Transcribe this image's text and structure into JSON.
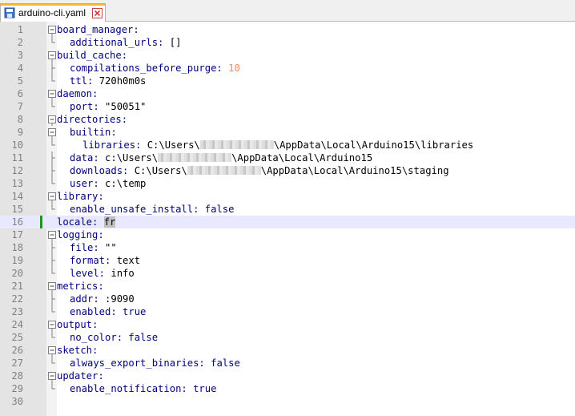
{
  "tab": {
    "filename": "arduino-cli.yaml"
  },
  "lines": [
    {
      "num": "1",
      "fold": "open",
      "indent": 0,
      "segments": [
        {
          "t": "board_manager:",
          "c": "k"
        }
      ]
    },
    {
      "num": "2",
      "fold": "end",
      "indent": 1,
      "segments": [
        {
          "t": "additional_urls:",
          "c": "k"
        },
        {
          "t": " []",
          "c": "v"
        }
      ]
    },
    {
      "num": "3",
      "fold": "open",
      "indent": 0,
      "segments": [
        {
          "t": "build_cache:",
          "c": "k"
        }
      ]
    },
    {
      "num": "4",
      "fold": "mid",
      "indent": 1,
      "segments": [
        {
          "t": "compilations_before_purge:",
          "c": "k"
        },
        {
          "t": " ",
          "c": "v"
        },
        {
          "t": "10",
          "c": "n"
        }
      ]
    },
    {
      "num": "5",
      "fold": "end",
      "indent": 1,
      "segments": [
        {
          "t": "ttl:",
          "c": "k"
        },
        {
          "t": " 720h0m0s",
          "c": "v"
        }
      ]
    },
    {
      "num": "6",
      "fold": "open",
      "indent": 0,
      "segments": [
        {
          "t": "daemon:",
          "c": "k"
        }
      ]
    },
    {
      "num": "7",
      "fold": "end",
      "indent": 1,
      "segments": [
        {
          "t": "port:",
          "c": "k"
        },
        {
          "t": " \"50051\"",
          "c": "v"
        }
      ]
    },
    {
      "num": "8",
      "fold": "open",
      "indent": 0,
      "segments": [
        {
          "t": "directories:",
          "c": "k"
        }
      ]
    },
    {
      "num": "9",
      "fold": "open2",
      "indent": 1,
      "segments": [
        {
          "t": "builtin:",
          "c": "k"
        }
      ]
    },
    {
      "num": "10",
      "fold": "end2",
      "indent": 2,
      "segments": [
        {
          "t": "libraries:",
          "c": "k"
        },
        {
          "t": " C:\\Users\\",
          "c": "v"
        },
        {
          "t": "",
          "c": "blur"
        },
        {
          "t": "\\AppData\\Local\\Arduino15\\libraries",
          "c": "v"
        }
      ]
    },
    {
      "num": "11",
      "fold": "mid",
      "indent": 1,
      "segments": [
        {
          "t": "data:",
          "c": "k"
        },
        {
          "t": " c:\\Users\\",
          "c": "v"
        },
        {
          "t": "",
          "c": "blur"
        },
        {
          "t": "\\AppData\\Local\\Arduino15",
          "c": "v"
        }
      ]
    },
    {
      "num": "12",
      "fold": "mid",
      "indent": 1,
      "segments": [
        {
          "t": "downloads:",
          "c": "k"
        },
        {
          "t": " C:\\Users\\",
          "c": "v"
        },
        {
          "t": "",
          "c": "blur"
        },
        {
          "t": "\\AppData\\Local\\Arduino15\\staging",
          "c": "v"
        }
      ]
    },
    {
      "num": "13",
      "fold": "end",
      "indent": 1,
      "segments": [
        {
          "t": "user:",
          "c": "k"
        },
        {
          "t": " c:\\temp",
          "c": "v"
        }
      ]
    },
    {
      "num": "14",
      "fold": "open",
      "indent": 0,
      "segments": [
        {
          "t": "library:",
          "c": "k"
        }
      ]
    },
    {
      "num": "15",
      "fold": "end",
      "indent": 1,
      "segments": [
        {
          "t": "enable_unsafe_install:",
          "c": "k"
        },
        {
          "t": " ",
          "c": "v"
        },
        {
          "t": "false",
          "c": "b"
        }
      ]
    },
    {
      "num": "16",
      "fold": "none",
      "indent": 0,
      "current": true,
      "changed": true,
      "segments": [
        {
          "t": "locale:",
          "c": "k"
        },
        {
          "t": " ",
          "c": "v"
        },
        {
          "t": "fr",
          "c": "sel"
        }
      ]
    },
    {
      "num": "17",
      "fold": "open",
      "indent": 0,
      "segments": [
        {
          "t": "logging:",
          "c": "k"
        }
      ]
    },
    {
      "num": "18",
      "fold": "mid",
      "indent": 1,
      "segments": [
        {
          "t": "file:",
          "c": "k"
        },
        {
          "t": " \"\"",
          "c": "v"
        }
      ]
    },
    {
      "num": "19",
      "fold": "mid",
      "indent": 1,
      "segments": [
        {
          "t": "format:",
          "c": "k"
        },
        {
          "t": " text",
          "c": "v"
        }
      ]
    },
    {
      "num": "20",
      "fold": "end",
      "indent": 1,
      "segments": [
        {
          "t": "level:",
          "c": "k"
        },
        {
          "t": " info",
          "c": "v"
        }
      ]
    },
    {
      "num": "21",
      "fold": "open",
      "indent": 0,
      "segments": [
        {
          "t": "metrics:",
          "c": "k"
        }
      ]
    },
    {
      "num": "22",
      "fold": "mid",
      "indent": 1,
      "segments": [
        {
          "t": "addr:",
          "c": "k"
        },
        {
          "t": " :9090",
          "c": "v"
        }
      ]
    },
    {
      "num": "23",
      "fold": "end",
      "indent": 1,
      "segments": [
        {
          "t": "enabled:",
          "c": "k"
        },
        {
          "t": " ",
          "c": "v"
        },
        {
          "t": "true",
          "c": "b"
        }
      ]
    },
    {
      "num": "24",
      "fold": "open",
      "indent": 0,
      "segments": [
        {
          "t": "output:",
          "c": "k"
        }
      ]
    },
    {
      "num": "25",
      "fold": "end",
      "indent": 1,
      "segments": [
        {
          "t": "no_color:",
          "c": "k"
        },
        {
          "t": " ",
          "c": "v"
        },
        {
          "t": "false",
          "c": "b"
        }
      ]
    },
    {
      "num": "26",
      "fold": "open",
      "indent": 0,
      "segments": [
        {
          "t": "sketch:",
          "c": "k"
        }
      ]
    },
    {
      "num": "27",
      "fold": "end",
      "indent": 1,
      "segments": [
        {
          "t": "always_export_binaries:",
          "c": "k"
        },
        {
          "t": " ",
          "c": "v"
        },
        {
          "t": "false",
          "c": "b"
        }
      ]
    },
    {
      "num": "28",
      "fold": "open",
      "indent": 0,
      "segments": [
        {
          "t": "updater:",
          "c": "k"
        }
      ]
    },
    {
      "num": "29",
      "fold": "end",
      "indent": 1,
      "segments": [
        {
          "t": "enable_notification:",
          "c": "k"
        },
        {
          "t": " ",
          "c": "v"
        },
        {
          "t": "true",
          "c": "b"
        }
      ]
    },
    {
      "num": "30",
      "fold": "none",
      "indent": 0,
      "segments": []
    }
  ],
  "colors": {
    "key": "#00007f",
    "number": "#f28a57",
    "changebar": "#1a9a1a",
    "current_line": "#e8e8ff"
  }
}
